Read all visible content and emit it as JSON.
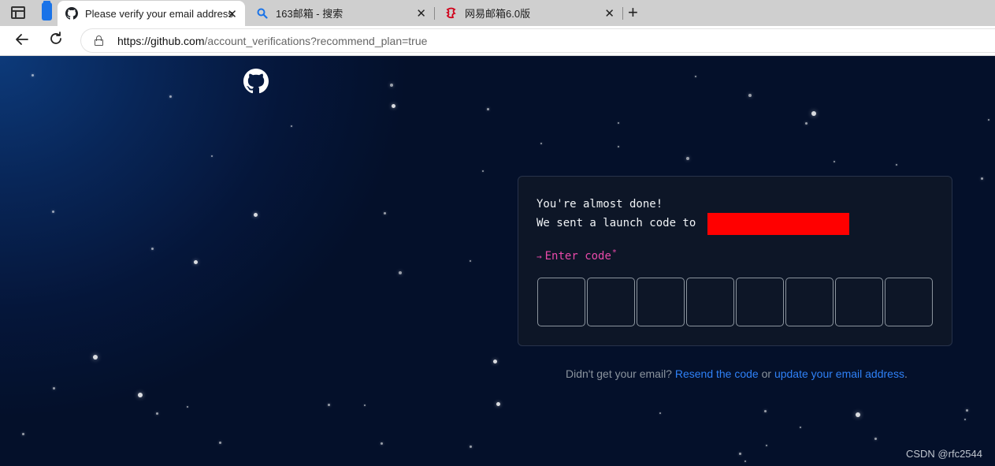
{
  "browser": {
    "tabs": [
      {
        "title": "Please verify your email address",
        "icon": "github-icon",
        "active": true
      },
      {
        "title": "163邮箱 - 搜索",
        "icon": "search-icon",
        "active": false
      },
      {
        "title": "网易邮箱6.0版",
        "icon": "netease-mail-icon",
        "active": false
      }
    ],
    "new_tab": "+",
    "close_glyph": "✕",
    "url_host": "https://github.com",
    "url_path": "/account_verifications?recommend_plan=true"
  },
  "verify": {
    "line1": "You're almost done!",
    "line2": "We sent a launch code to",
    "code_label": "Enter code",
    "required_mark": "*",
    "code_length": 8
  },
  "footer": {
    "prefix": "Didn't get your email? ",
    "resend_link": "Resend the code",
    "middle": " or ",
    "update_link": "update your email address",
    "suffix": "."
  },
  "watermark": "CSDN @rfc2544",
  "colors": {
    "accent_pink": "#ea4aaa",
    "link_blue": "#2f81f7",
    "redaction": "#ff0000"
  }
}
